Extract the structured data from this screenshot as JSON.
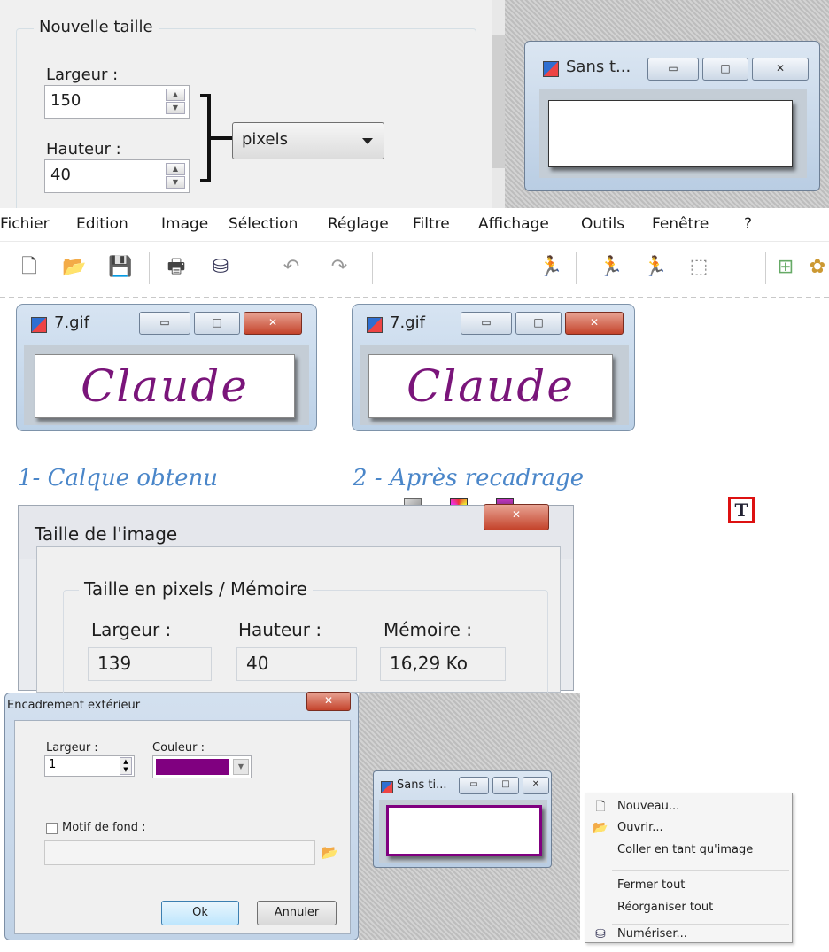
{
  "nouvelle_taille": {
    "group_title": "Nouvelle taille",
    "largeur_label": "Largeur :",
    "largeur_value": "150",
    "hauteur_label": "Hauteur :",
    "hauteur_value": "40",
    "unit": "pixels"
  },
  "mini_window_1": {
    "title": "Sans t..."
  },
  "menubar": {
    "items": [
      "Fichier",
      "Edition",
      "Image",
      "Sélection",
      "Réglage",
      "Filtre",
      "Affichage",
      "Outils",
      "Fenêtre",
      "?"
    ]
  },
  "toolbar": {
    "icons": [
      "new-file-icon",
      "open-folder-icon",
      "save-icon",
      "print-icon",
      "scan-icon",
      "undo-icon",
      "redo-icon",
      "gray-square-icon",
      "color-grid-icon",
      "runner-icon",
      "runner-copy-icon",
      "runner-frame-icon",
      "selection-icon",
      "text-tool-icon",
      "tree-icon",
      "gear-flower-icon"
    ]
  },
  "claude_windows": [
    {
      "title": "7.gif",
      "text": "Claude"
    },
    {
      "title": "7.gif",
      "text": "Claude"
    }
  ],
  "captions": {
    "first": "1- Calque obtenu",
    "second": "2 - Après recadrage"
  },
  "taille_image": {
    "title": "Taille de l'image",
    "group_title": "Taille en pixels / Mémoire",
    "largeur_label": "Largeur :",
    "largeur_value": "139",
    "hauteur_label": "Hauteur :",
    "hauteur_value": "40",
    "memoire_label": "Mémoire :",
    "memoire_value": "16,29 Ko"
  },
  "encadrement": {
    "title": "Encadrement extérieur",
    "largeur_label": "Largeur :",
    "largeur_value": "1",
    "couleur_label": "Couleur :",
    "couleur_value": "#800080",
    "motif_label": "Motif de fond :",
    "ok_label": "Ok",
    "annuler_label": "Annuler"
  },
  "mini_window_2": {
    "title": "Sans ti..."
  },
  "context_menu": {
    "nouveau": "Nouveau...",
    "ouvrir": "Ouvrir...",
    "coller": "Coller en tant qu'image",
    "fermer": "Fermer tout",
    "reorganiser": "Réorganiser tout",
    "numeriser": "Numériser..."
  },
  "colors": {
    "claude_text": "#7a157a",
    "caption": "#4a86c9",
    "frame_purple": "#800080"
  }
}
